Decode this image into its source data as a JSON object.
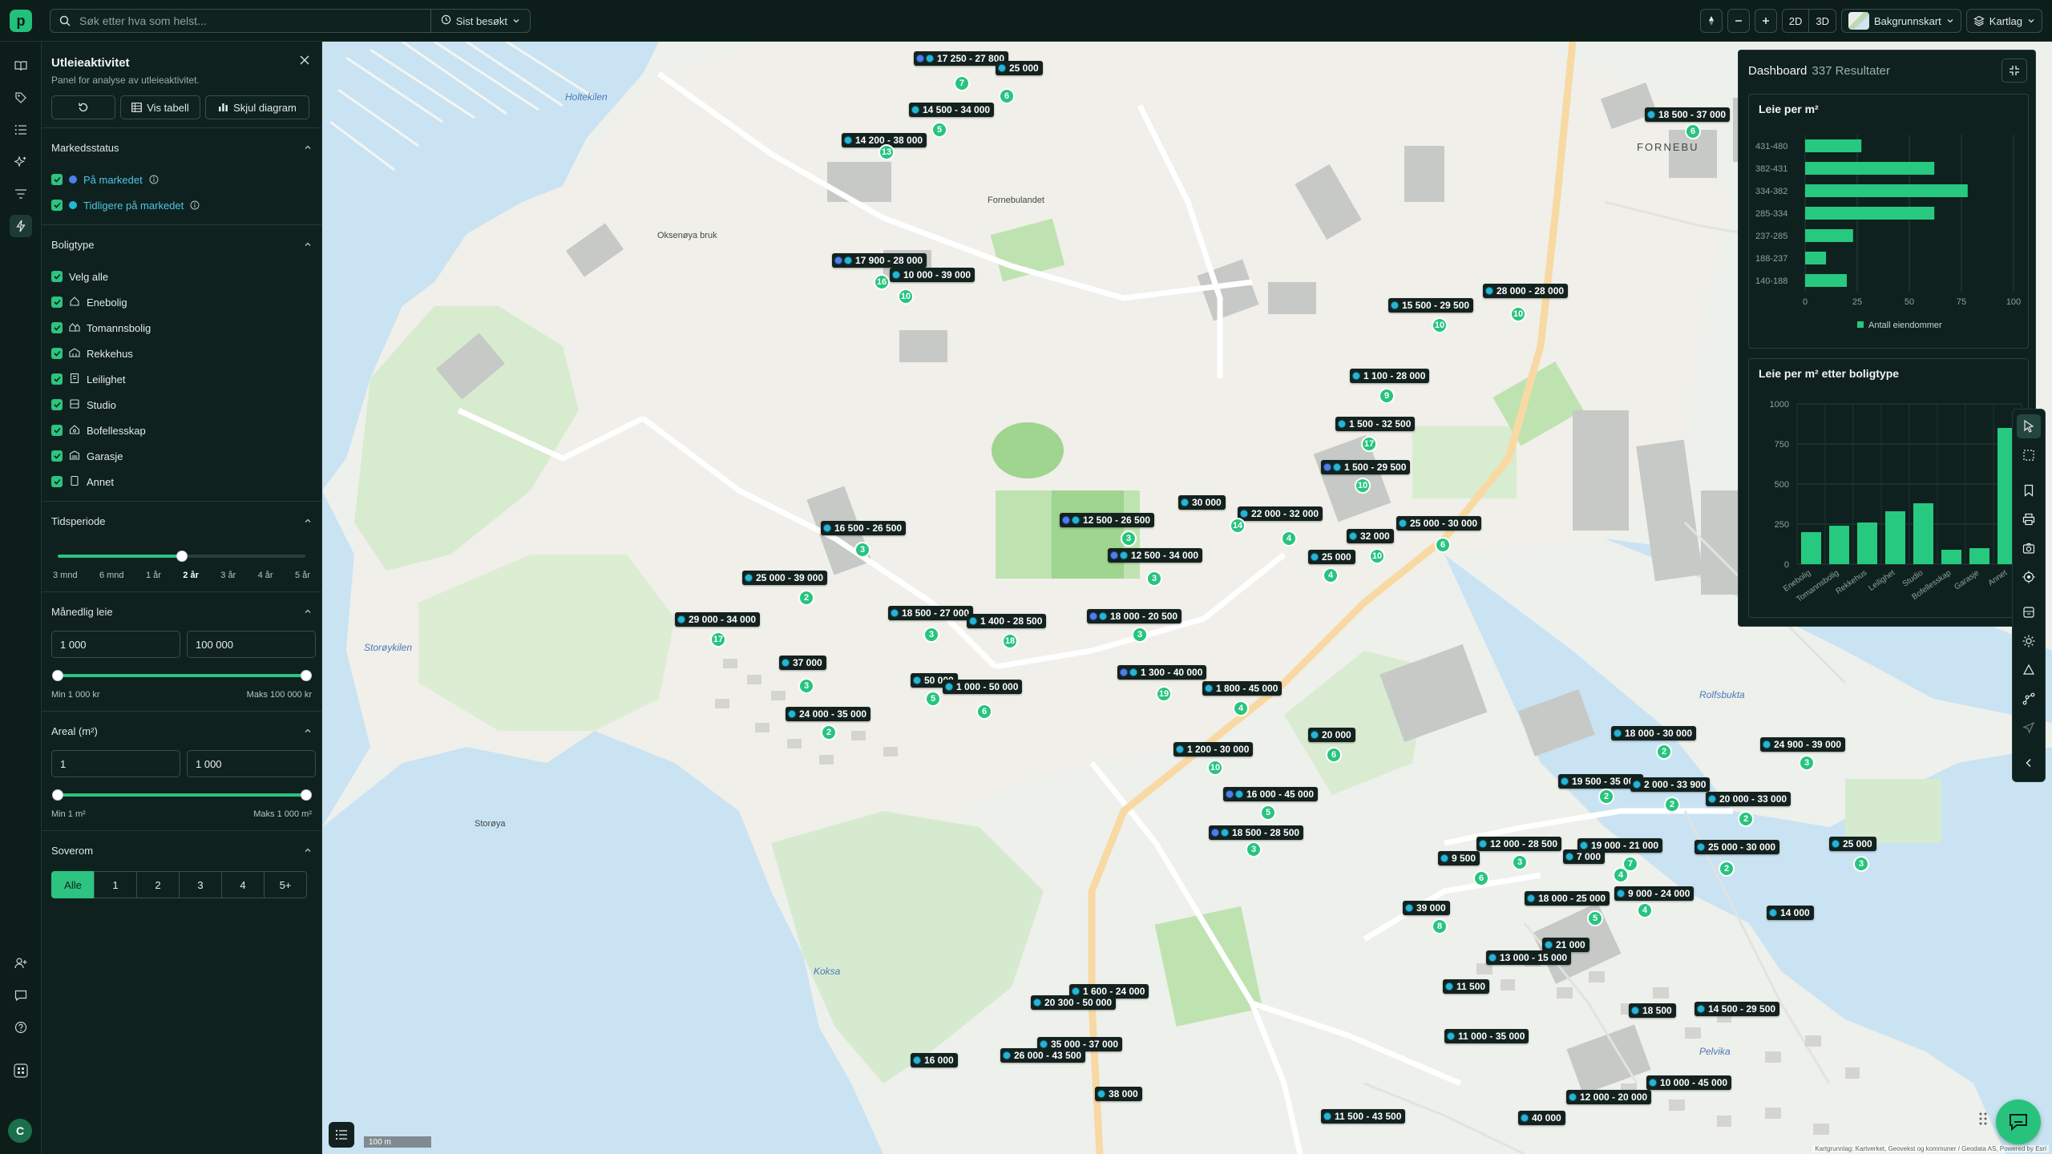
{
  "search": {
    "placeholder": "Søk etter hva som helst...",
    "recent_label": "Sist besøkt"
  },
  "toolbar": {
    "view_2d": "2D",
    "view_3d": "3D",
    "background_label": "Bakgrunnskart",
    "layers_label": "Kartlag"
  },
  "user": {
    "initial": "C"
  },
  "panel": {
    "title": "Utleieaktivitet",
    "subtitle": "Panel for analyse av utleieaktivitet.",
    "show_table": "Vis tabell",
    "hide_chart": "Skjul diagram",
    "market_status": {
      "title": "Markedsstatus",
      "items": [
        {
          "label": "På markedet",
          "color": "#4f7ee8"
        },
        {
          "label": "Tidligere på markedet",
          "color": "#27b5d6"
        }
      ]
    },
    "property_type": {
      "title": "Boligtype",
      "items": [
        {
          "label": "Velg alle",
          "icon": ""
        },
        {
          "label": "Enebolig",
          "icon": "house-icon"
        },
        {
          "label": "Tomannsbolig",
          "icon": "duplex-icon"
        },
        {
          "label": "Rekkehus",
          "icon": "townhouse-icon"
        },
        {
          "label": "Leilighet",
          "icon": "apartment-icon"
        },
        {
          "label": "Studio",
          "icon": "studio-icon"
        },
        {
          "label": "Bofellesskap",
          "icon": "shared-housing-icon"
        },
        {
          "label": "Garasje",
          "icon": "garage-icon"
        },
        {
          "label": "Annet",
          "icon": "other-icon"
        }
      ]
    },
    "period": {
      "title": "Tidsperiode",
      "ticks": [
        "3 mnd",
        "6 mnd",
        "1 år",
        "2 år",
        "3 år",
        "4 år",
        "5 år"
      ],
      "selected": "2 år",
      "selected_index": 3
    },
    "rent": {
      "title": "Månedlig leie",
      "min": "1 000",
      "max": "100 000",
      "min_label": "Min 1 000 kr",
      "max_label": "Maks 100 000 kr",
      "range": [
        0,
        1
      ]
    },
    "area": {
      "title": "Areal (m²)",
      "min": "1",
      "max": "1 000",
      "min_label": "Min 1 m²",
      "max_label": "Maks 1 000 m²",
      "range": [
        0,
        1
      ]
    },
    "bedrooms": {
      "title": "Soverom",
      "options": [
        "Alle",
        "1",
        "2",
        "3",
        "4",
        "5+"
      ],
      "selected": "Alle"
    }
  },
  "map": {
    "water_labels": [
      "Holtekilen",
      "Storøykilen",
      "Koksa",
      "Rolfsbukta",
      "Pelvika"
    ],
    "place_labels": [
      "FORNEBU",
      "Storøya",
      "Oksenøya bruk",
      "Fornebulandet"
    ],
    "scale_label": "100 m",
    "attribution": "Kartgrunnlag: Kartverket, Geovekst og kommuner / Geodata AS, Powered by Esri",
    "pins": [
      {
        "label": "17 250 - 27 800",
        "double": true
      },
      {
        "label": "25 000",
        "double": false
      },
      {
        "label": "14 500 - 34 000",
        "double": false
      },
      {
        "label": "14 200 - 38 000",
        "double": false
      },
      {
        "label": "18 500 - 37 000",
        "double": false
      },
      {
        "label": "17 900 - 28 000",
        "double": true
      },
      {
        "label": "10 000 - 39 000",
        "double": false
      },
      {
        "label": "28 000 - 28 000",
        "double": false
      },
      {
        "label": "15 500 - 29 500",
        "double": false
      },
      {
        "label": "1 100 - 28 000",
        "double": false
      },
      {
        "label": "1 500 - 32 500",
        "double": false
      },
      {
        "label": "1 500 - 29 500",
        "double": true
      },
      {
        "label": "30 000",
        "double": false
      },
      {
        "label": "22 000 - 32 000",
        "double": false
      },
      {
        "label": "25 000 - 30 000",
        "double": false
      },
      {
        "label": "12 500 - 26 500",
        "double": true
      },
      {
        "label": "32 000",
        "double": false
      },
      {
        "label": "16 500 - 26 500",
        "double": false
      },
      {
        "label": "12 500 - 34 000",
        "double": true
      },
      {
        "label": "25 000",
        "double": false
      },
      {
        "label": "25 000 - 39 000",
        "double": false
      },
      {
        "label": "18 500 - 27 000",
        "double": false
      },
      {
        "label": "29 000 - 34 000",
        "double": false
      },
      {
        "label": "1 400 - 28 500",
        "double": false
      },
      {
        "label": "18 000 - 20 500",
        "double": true
      },
      {
        "label": "37 000",
        "double": false
      },
      {
        "label": "50 000",
        "double": false
      },
      {
        "label": "1 000 - 50 000",
        "double": false
      },
      {
        "label": "1 300 - 40 000",
        "double": true
      },
      {
        "label": "1 800 - 45 000",
        "double": false
      },
      {
        "label": "24 000 - 35 000",
        "double": false
      },
      {
        "label": "20 000",
        "double": false
      },
      {
        "label": "1 200 - 30 000",
        "double": false
      },
      {
        "label": "18 000 - 30 000",
        "double": false
      },
      {
        "label": "24 900 - 39 000",
        "double": false
      },
      {
        "label": "19 500 - 35 000",
        "double": false
      },
      {
        "label": "2 000 - 33 900",
        "double": false
      },
      {
        "label": "16 000 - 45 000",
        "double": true
      },
      {
        "label": "20 000 - 33 000",
        "double": false
      },
      {
        "label": "18 500 - 28 500",
        "double": true
      },
      {
        "label": "12 000 - 28 500",
        "double": false
      },
      {
        "label": "19 000 - 21 000",
        "double": false
      },
      {
        "label": "25 000 - 30 000",
        "double": false
      },
      {
        "label": "25 000",
        "double": false
      },
      {
        "label": "9 500",
        "double": false
      },
      {
        "label": "7 000",
        "double": false
      },
      {
        "label": "39 000",
        "double": false
      },
      {
        "label": "18 000 - 25 000",
        "double": false
      },
      {
        "label": "9 000 - 24 000",
        "double": false
      },
      {
        "label": "14 000",
        "double": false
      },
      {
        "label": "21 000",
        "double": false
      },
      {
        "label": "13 000 - 15 000",
        "double": false
      },
      {
        "label": "1 600 - 24 000",
        "double": false
      },
      {
        "label": "11 500",
        "double": false
      },
      {
        "label": "20 300 - 50 000",
        "double": false
      },
      {
        "label": "18 500",
        "double": false
      },
      {
        "label": "14 500 - 29 500",
        "double": false
      },
      {
        "label": "35 000 - 37 000",
        "double": false
      },
      {
        "label": "11 000 - 35 000",
        "double": false
      },
      {
        "label": "26 000 - 43 500",
        "double": false
      },
      {
        "label": "16 000",
        "double": false
      },
      {
        "label": "38 000",
        "double": false
      },
      {
        "label": "10 000 - 45 000",
        "double": false
      },
      {
        "label": "12 000 - 20 000",
        "double": false
      },
      {
        "label": "11 500 - 43 500",
        "double": false
      },
      {
        "label": "40 000",
        "double": false
      }
    ],
    "clusters": [
      "7",
      "6",
      "5",
      "13",
      "6",
      "16",
      "10",
      "10",
      "10",
      "9",
      "17",
      "10",
      "14",
      "4",
      "6",
      "3",
      "10",
      "3",
      "3",
      "4",
      "2",
      "3",
      "17",
      "18",
      "3",
      "3",
      "5",
      "6",
      "19",
      "4",
      "2",
      "6",
      "10",
      "2",
      "3",
      "2",
      "2",
      "5",
      "2",
      "3",
      "3",
      "7",
      "2",
      "3",
      "6",
      "4",
      "8",
      "5",
      "4"
    ]
  },
  "dashboard": {
    "title": "Dashboard",
    "results": "337 Resultater",
    "chart1_title": "Leie per m²",
    "chart2_title": "Leie per m² etter boligtype",
    "legend": "Antall eiendommer"
  },
  "chart_data": [
    {
      "type": "bar",
      "orientation": "horizontal",
      "title": "Leie per m²",
      "categories": [
        "431-480",
        "382-431",
        "334-382",
        "285-334",
        "237-285",
        "188-237",
        "140-188"
      ],
      "series": [
        {
          "name": "Antall eiendommer",
          "values": [
            27,
            62,
            78,
            62,
            23,
            10,
            20
          ]
        }
      ],
      "xticks": [
        "0",
        "25",
        "50",
        "75",
        "100"
      ],
      "xlim": [
        0,
        100
      ],
      "color": "#26c97f"
    },
    {
      "type": "bar",
      "title": "Leie per m² etter boligtype",
      "categories": [
        "Enebolig",
        "Tomannsbolig",
        "Rekkehus",
        "Leilighet",
        "Studio",
        "Bofellesskap",
        "Garasje",
        "Annet"
      ],
      "values": [
        200,
        240,
        260,
        330,
        380,
        90,
        100,
        850
      ],
      "yticks": [
        "0",
        "250",
        "500",
        "750",
        "1000"
      ],
      "ylim": [
        0,
        1000
      ],
      "color": "#26c97f"
    }
  ]
}
